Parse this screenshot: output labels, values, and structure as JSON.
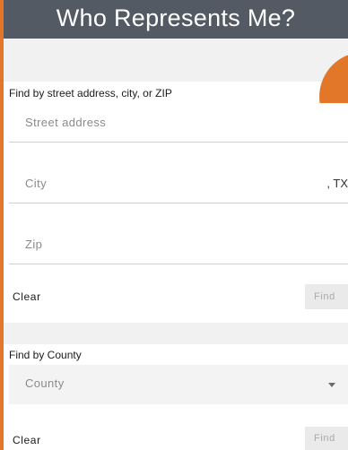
{
  "header": {
    "title": "Who Represents Me?"
  },
  "address_section": {
    "label": "Find by street address, city, or ZIP",
    "street_placeholder": "Street address",
    "city_placeholder": "City",
    "state_suffix": ", TX",
    "zip_placeholder": "Zip",
    "clear_label": "Clear",
    "find_label": "Find"
  },
  "county_section": {
    "label": "Find by County",
    "county_selected": "County",
    "clear_label": "Clear",
    "find_label": "Find"
  },
  "colors": {
    "accent": "#e2772a",
    "header_bg": "#545a64"
  }
}
